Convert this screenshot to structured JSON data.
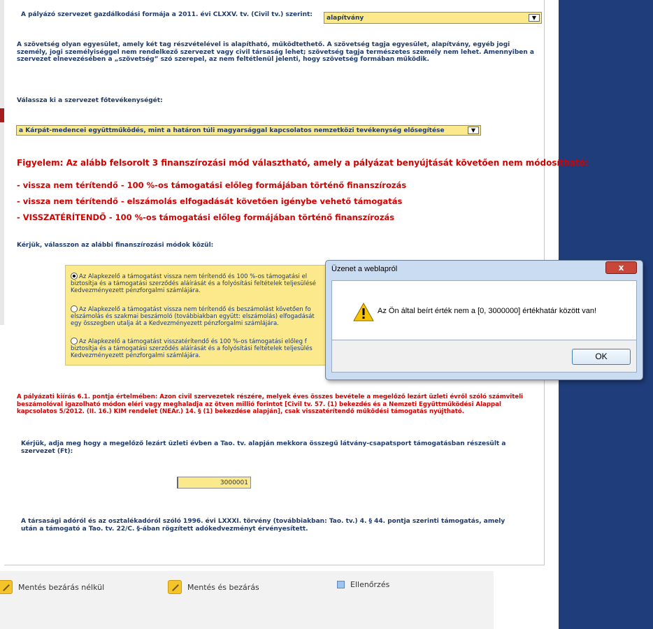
{
  "org_form": {
    "label": "A pályázó szervezet gazdálkodási formája a 2011. évi CLXXV. tv. (Civil tv.) szerint:",
    "value": "alapítvány"
  },
  "federation_note": "A szövetség olyan egyesület, amely két tag részvételével is alapítható, működtethető. A szövetség tagja egyesület, alapítvány, egyéb jogi személy, jogi személyiséggel nem rendelkező szervezet vagy civil társaság lehet; szövetség tagja természetes személy nem lehet. Amennyiben a szervezet elnevezésében a „szövetség” szó szerepel, az nem feltétlenül jelenti, hogy szövetség formában működik.",
  "main_activity": {
    "label": "Válassza ki a szervezet főtevékenységét:",
    "value": "a Kárpát-medencei együttműködés, mint a határon túli magyarsággal kapcsolatos nemzetközi tevékenység elősegítése"
  },
  "warning": {
    "heading": "Figyelem: Az alább felsorolt 3 finanszírozási mód választható, amely a pályázat benyújtását követően nem módosítható:",
    "items": [
      "- vissza nem térítendő - 100 %-os támogatási előleg formájában történő finanszírozás",
      "- vissza nem térítendő - elszámolás elfogadását követően igénybe vehető támogatás",
      "- VISSZATÉRÍTENDŐ - 100 %-os támogatási előleg formájában történő finanszírozás"
    ]
  },
  "financing": {
    "label": "Kérjük, válasszon az alábbi finanszírozási módok közül:",
    "options": [
      {
        "line1": "Az Alapkezelő a támogatást vissza nem térítendő és 100 %-os támogatási el",
        "line2": "biztosítja és a támogatási szerződés aláírását és a folyósítási feltételek teljesülésé",
        "line3": "Kedvezményezett pénzforgalmi számlájára.",
        "selected": true
      },
      {
        "line1": "Az Alapkezelő a támogatást vissza nem térítendő és beszámolást követően fo",
        "line2": "elszámolás és szakmai beszámoló (továbbiakban együtt: elszámolás) elfogadását",
        "line3": "egy összegben utalja át a Kedvezményezett pénzforgalmi számlájára.",
        "selected": false
      },
      {
        "line1": "Az Alapkezelő a támogatást visszatérítendő és 100 %-os támogatási előleg f",
        "line2": "biztosítja és a támogatási szerződés aláírását és a folyósítási feltételek teljesülés",
        "line3": "Kedvezményezett pénzforgalmi számlájára.",
        "selected": false
      }
    ]
  },
  "notice_61": "A pályázati kiírás 6.1. pontja értelmében: Azon civil szervezetek részére, melyek éves összes bevétele a megelőző lezárt üzleti évről szóló számviteli beszámolóval igazolható módon eléri vagy meghaladja az ötven millió forintot [Civil tv. 57. (1) bekezdés és a Nemzeti Együttműködési Alappal kapcsolatos 5/2012. (II. 16.) KIM rendelet (NEAr.) 14. § (1) bekezdése alapján], csak visszatérítendő működési támogatás nyújtható.",
  "tao": {
    "question": "Kérjük, adja meg hogy a megelőző lezárt üzleti évben a Tao. tv. alapján mekkora összegű látvány-csapatsport támogatásban részesült a szervezet (Ft):",
    "value": "3000001",
    "footnote": "A társasági adóról és az osztalékadóról szóló 1996. évi LXXXI. törvény (továbbiakban: Tao. tv.) 4. § 44. pontja szerinti támogatás, amely után a támogató a Tao. tv. 22/C. §-ában rögzített adókedvezményt érvényesített."
  },
  "bottom_actions": {
    "save_no_close": "Mentés bezárás nélkül",
    "save_close": "Mentés és bezárás",
    "check": "Ellenőrzés"
  },
  "dialog": {
    "title": "Üzenet a weblapról",
    "message": "Az Ön által beírt érték nem a [0, 3000000]  értékhatár között van!",
    "ok": "OK",
    "close_glyph": "x"
  }
}
